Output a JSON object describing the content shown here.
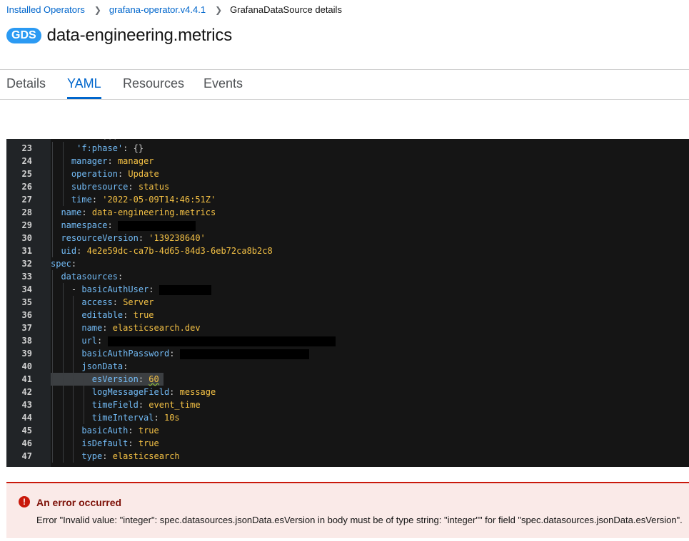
{
  "breadcrumb": {
    "items": [
      "Installed Operators",
      "grafana-operator.v4.4.1"
    ],
    "current": "GrafanaDataSource details"
  },
  "header": {
    "badge": "GDS",
    "title": "data-engineering.metrics"
  },
  "tabs": [
    {
      "label": "Details",
      "active": false
    },
    {
      "label": "YAML",
      "active": true
    },
    {
      "label": "Resources",
      "active": false
    },
    {
      "label": "Events",
      "active": false
    }
  ],
  "editor": {
    "lines": [
      {
        "n": "23",
        "indent": 5,
        "key": "'f:phase'",
        "value": "{}",
        "vtype": "punc"
      },
      {
        "n": "24",
        "indent": 4,
        "key": "manager",
        "value": "manager",
        "vtype": "str"
      },
      {
        "n": "25",
        "indent": 4,
        "key": "operation",
        "value": "Update",
        "vtype": "str"
      },
      {
        "n": "26",
        "indent": 4,
        "key": "subresource",
        "value": "status",
        "vtype": "str"
      },
      {
        "n": "27",
        "indent": 4,
        "key": "time",
        "value": "'2022-05-09T14:46:51Z'",
        "vtype": "str"
      },
      {
        "n": "28",
        "indent": 2,
        "key": "name",
        "value": "data-engineering.metrics",
        "vtype": "str"
      },
      {
        "n": "29",
        "indent": 2,
        "key": "namespace",
        "value": "",
        "vtype": "redact",
        "redact_chars": 15
      },
      {
        "n": "30",
        "indent": 2,
        "key": "resourceVersion",
        "value": "'139238640'",
        "vtype": "str"
      },
      {
        "n": "31",
        "indent": 2,
        "key": "uid",
        "value": "4e2e59dc-ca7b-4d65-84d3-6eb72ca8b2c8",
        "vtype": "str"
      },
      {
        "n": "32",
        "indent": 0,
        "key": "spec",
        "value": "",
        "vtype": "none"
      },
      {
        "n": "33",
        "indent": 2,
        "key": "datasources",
        "value": "",
        "vtype": "none"
      },
      {
        "n": "34",
        "indent": 4,
        "dash": true,
        "key": "basicAuthUser",
        "value": "",
        "vtype": "redact",
        "redact_chars": 10
      },
      {
        "n": "35",
        "indent": 6,
        "key": "access",
        "value": "Server",
        "vtype": "str"
      },
      {
        "n": "36",
        "indent": 6,
        "key": "editable",
        "value": "true",
        "vtype": "str"
      },
      {
        "n": "37",
        "indent": 6,
        "key": "name",
        "value": "elasticsearch.dev",
        "vtype": "str"
      },
      {
        "n": "38",
        "indent": 6,
        "key": "url",
        "value": "",
        "vtype": "redact",
        "redact_chars": 44
      },
      {
        "n": "39",
        "indent": 6,
        "key": "basicAuthPassword",
        "value": "",
        "vtype": "redact",
        "redact_chars": 25
      },
      {
        "n": "40",
        "indent": 6,
        "key": "jsonData",
        "value": "",
        "vtype": "none"
      },
      {
        "n": "41",
        "indent": 8,
        "key": "esVersion",
        "value": "60",
        "vtype": "num",
        "highlight": true
      },
      {
        "n": "42",
        "indent": 8,
        "key": "logMessageField",
        "value": "message",
        "vtype": "str"
      },
      {
        "n": "43",
        "indent": 8,
        "key": "timeField",
        "value": "event_time",
        "vtype": "str"
      },
      {
        "n": "44",
        "indent": 8,
        "key": "timeInterval",
        "value": "10s",
        "vtype": "str"
      },
      {
        "n": "45",
        "indent": 6,
        "key": "basicAuth",
        "value": "true",
        "vtype": "str"
      },
      {
        "n": "46",
        "indent": 6,
        "key": "isDefault",
        "value": "true",
        "vtype": "str"
      },
      {
        "n": "47",
        "indent": 6,
        "key": "type",
        "value": "elasticsearch",
        "vtype": "str"
      }
    ]
  },
  "alert": {
    "icon": "exclamation-circle-icon",
    "title": "An error occurred",
    "message": "Error \"Invalid value: \"integer\": spec.datasources.jsonData.esVersion in body must be of type string: \"integer\"\" for field \"spec.datasources.jsonData.esVersion\"."
  },
  "colors": {
    "link": "#0066cc",
    "badge": "#2b9af3",
    "danger": "#c9190b",
    "editor_bg": "#151515"
  }
}
